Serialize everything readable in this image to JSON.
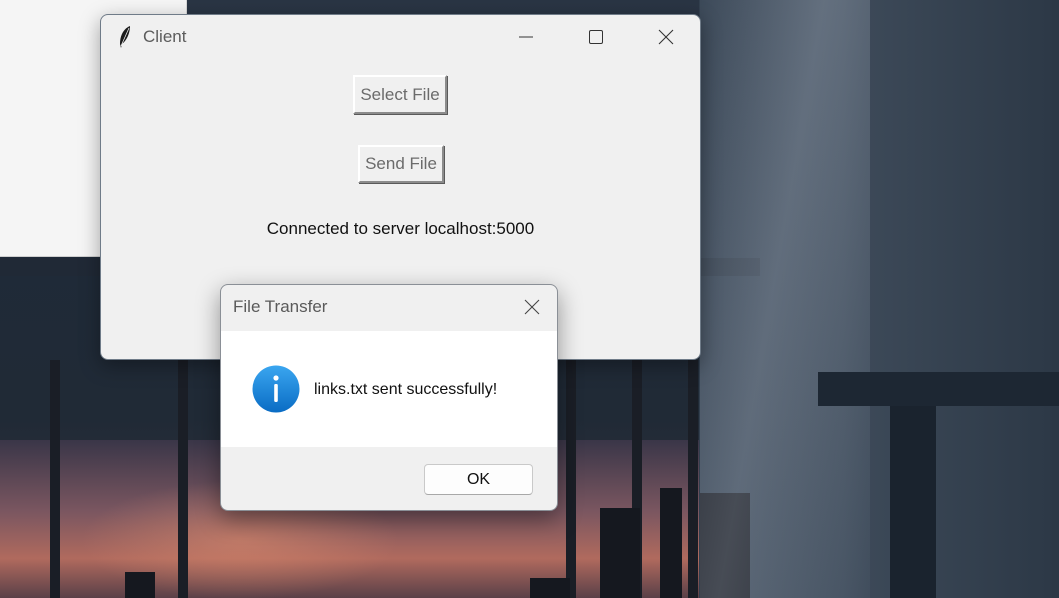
{
  "client_window": {
    "title": "Client",
    "select_file_label": "Select File",
    "send_file_label": "Send File",
    "status_text": "Connected to server localhost:5000"
  },
  "dialog": {
    "title": "File Transfer",
    "message": "links.txt sent successfully!",
    "ok_label": "OK",
    "icon": "info-icon"
  },
  "colors": {
    "info_icon_blue": "#1e88d8",
    "window_background": "#f0f0f0",
    "dialog_body": "#ffffff"
  }
}
